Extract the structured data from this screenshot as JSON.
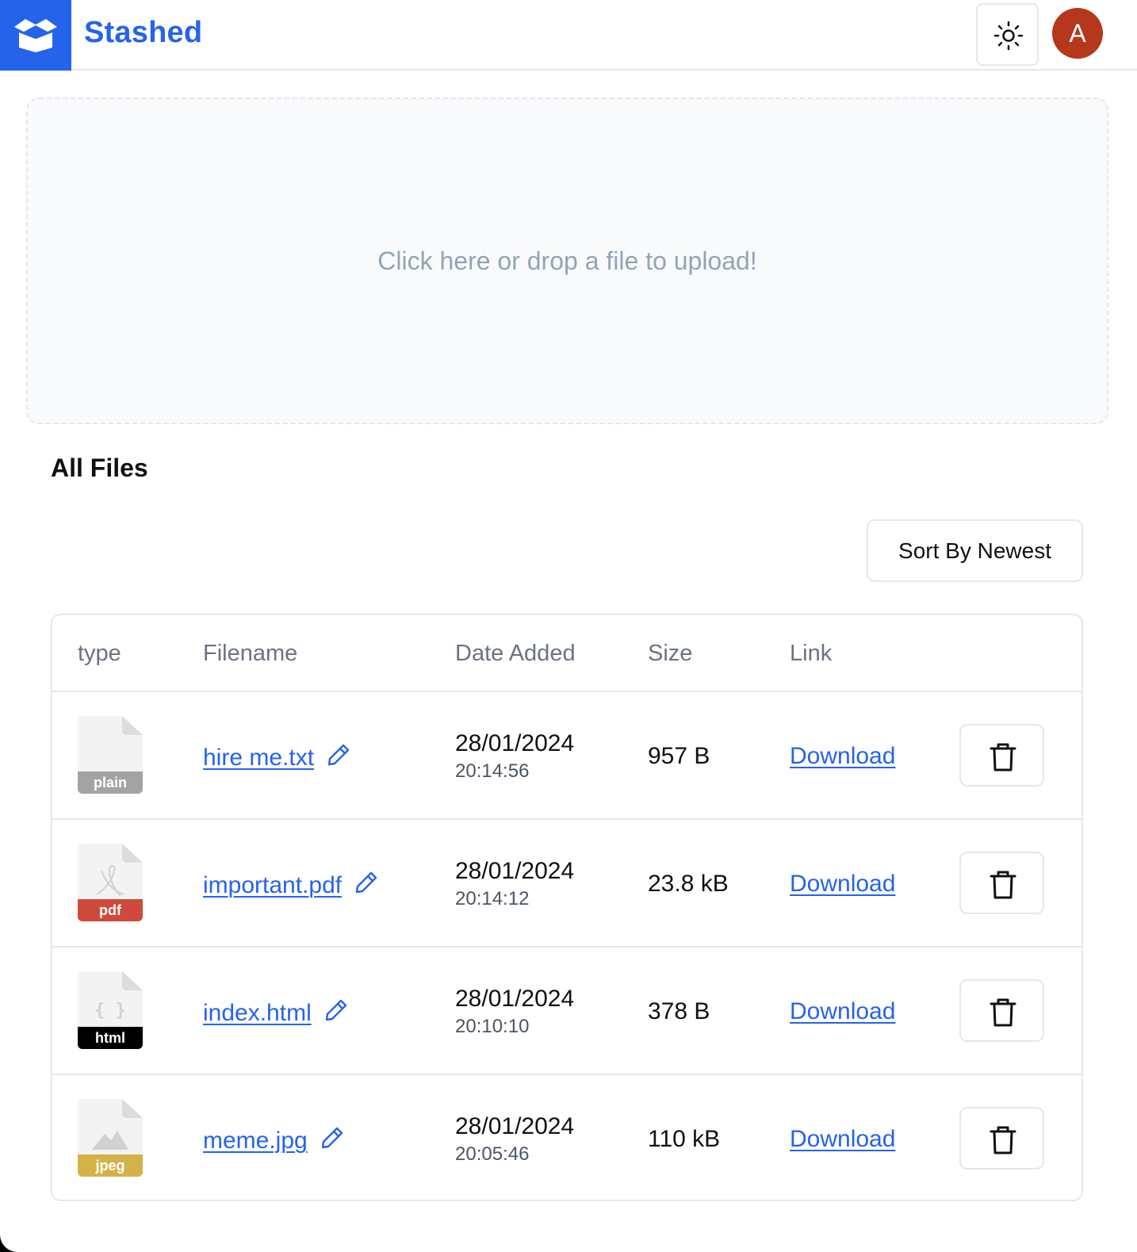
{
  "app": {
    "brand": "Stashed",
    "avatar_initial": "A",
    "accent": "#2563eb",
    "avatar_color": "#b5381c"
  },
  "header": {
    "theme_icon": "sun-icon",
    "logo_icon": "open-box-icon"
  },
  "upload": {
    "prompt": "Click here or drop a file to upload!"
  },
  "files": {
    "title": "All Files",
    "sort_label": "Sort By Newest",
    "columns": [
      "type",
      "Filename",
      "Date Added",
      "Size",
      "Link"
    ],
    "rows": [
      {
        "type": "plain",
        "type_color": "#a3a3a3",
        "glyph": "",
        "name": "hire me.txt",
        "date": "28/01/2024",
        "time": "20:14:56",
        "size": "957 B",
        "link": "Download"
      },
      {
        "type": "pdf",
        "type_color": "#cf4a3c",
        "glyph": "acrobat",
        "name": "important.pdf",
        "date": "28/01/2024",
        "time": "20:14:12",
        "size": "23.8 kB",
        "link": "Download"
      },
      {
        "type": "html",
        "type_color": "#000000",
        "glyph": "{ }",
        "name": "index.html",
        "date": "28/01/2024",
        "time": "20:10:10",
        "size": "378 B",
        "link": "Download"
      },
      {
        "type": "jpeg",
        "type_color": "#d4b24a",
        "glyph": "mountain",
        "name": "meme.jpg",
        "date": "28/01/2024",
        "time": "20:05:46",
        "size": "110 kB",
        "link": "Download"
      }
    ]
  }
}
